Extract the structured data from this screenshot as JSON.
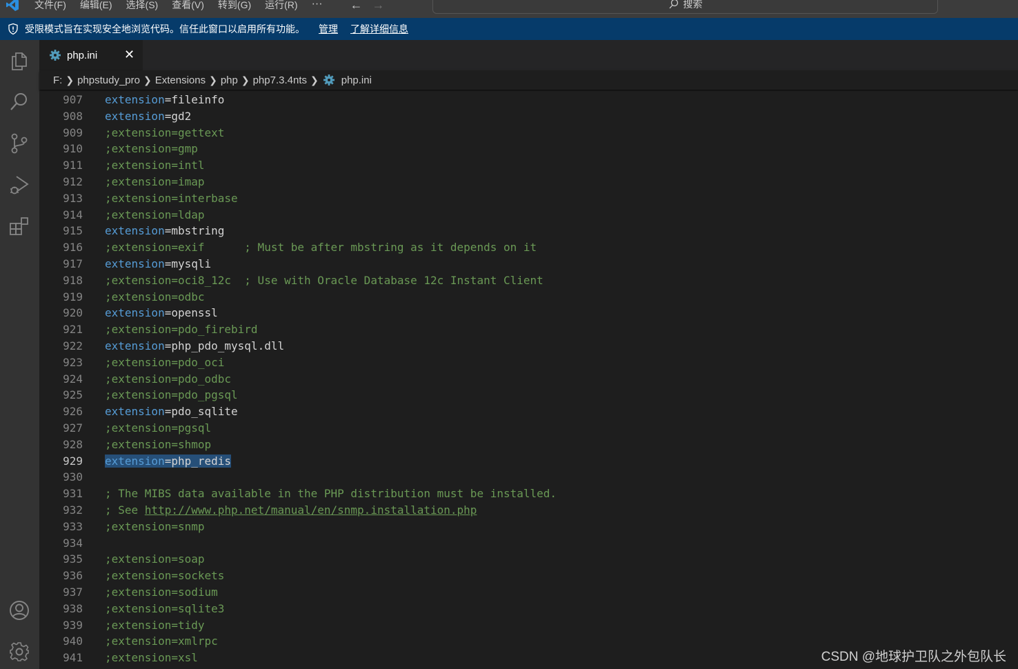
{
  "titlebar": {
    "menu": [
      "文件(F)",
      "编辑(E)",
      "选择(S)",
      "查看(V)",
      "转到(G)",
      "运行(R)"
    ],
    "more": "···",
    "back_icon": "←",
    "forward_icon": "→",
    "search_label": "搜索"
  },
  "banner": {
    "message": "受限模式旨在实现安全地浏览代码。信任此窗口以启用所有功能。",
    "manage": "管理",
    "learn_more": "了解详细信息"
  },
  "tab": {
    "label": "php.ini",
    "close": "✕"
  },
  "breadcrumb": [
    "F:",
    "phpstudy_pro",
    "Extensions",
    "php",
    "php7.3.4nts",
    "php.ini"
  ],
  "editor": {
    "active_line": "929",
    "lines": [
      {
        "n": "907",
        "kind": "ext",
        "kw": "extension",
        "val": "fileinfo"
      },
      {
        "n": "908",
        "kind": "ext",
        "kw": "extension",
        "val": "gd2"
      },
      {
        "n": "909",
        "kind": "comment",
        "text": ";extension=gettext"
      },
      {
        "n": "910",
        "kind": "comment",
        "text": ";extension=gmp"
      },
      {
        "n": "911",
        "kind": "comment",
        "text": ";extension=intl"
      },
      {
        "n": "912",
        "kind": "comment",
        "text": ";extension=imap"
      },
      {
        "n": "913",
        "kind": "comment",
        "text": ";extension=interbase"
      },
      {
        "n": "914",
        "kind": "comment",
        "text": ";extension=ldap"
      },
      {
        "n": "915",
        "kind": "ext",
        "kw": "extension",
        "val": "mbstring"
      },
      {
        "n": "916",
        "kind": "comment",
        "text": ";extension=exif      ; Must be after mbstring as it depends on it"
      },
      {
        "n": "917",
        "kind": "ext",
        "kw": "extension",
        "val": "mysqli"
      },
      {
        "n": "918",
        "kind": "comment",
        "text": ";extension=oci8_12c  ; Use with Oracle Database 12c Instant Client"
      },
      {
        "n": "919",
        "kind": "comment",
        "text": ";extension=odbc"
      },
      {
        "n": "920",
        "kind": "ext",
        "kw": "extension",
        "val": "openssl"
      },
      {
        "n": "921",
        "kind": "comment",
        "text": ";extension=pdo_firebird"
      },
      {
        "n": "922",
        "kind": "ext",
        "kw": "extension",
        "val": "php_pdo_mysql.dll"
      },
      {
        "n": "923",
        "kind": "comment",
        "text": ";extension=pdo_oci"
      },
      {
        "n": "924",
        "kind": "comment",
        "text": ";extension=pdo_odbc"
      },
      {
        "n": "925",
        "kind": "comment",
        "text": ";extension=pdo_pgsql"
      },
      {
        "n": "926",
        "kind": "ext",
        "kw": "extension",
        "val": "pdo_sqlite"
      },
      {
        "n": "927",
        "kind": "comment",
        "text": ";extension=pgsql"
      },
      {
        "n": "928",
        "kind": "comment",
        "text": ";extension=shmop"
      },
      {
        "n": "929",
        "kind": "ext",
        "kw": "extension",
        "val": "php_redis",
        "selected": true
      },
      {
        "n": "930",
        "kind": "empty",
        "text": ""
      },
      {
        "n": "931",
        "kind": "comment",
        "text": "; The MIBS data available in the PHP distribution must be installed."
      },
      {
        "n": "932",
        "kind": "see",
        "text": "; See ",
        "url": "http://www.php.net/manual/en/snmp.installation.php"
      },
      {
        "n": "933",
        "kind": "comment",
        "text": ";extension=snmp"
      },
      {
        "n": "934",
        "kind": "empty",
        "text": ""
      },
      {
        "n": "935",
        "kind": "comment",
        "text": ";extension=soap"
      },
      {
        "n": "936",
        "kind": "comment",
        "text": ";extension=sockets"
      },
      {
        "n": "937",
        "kind": "comment",
        "text": ";extension=sodium"
      },
      {
        "n": "938",
        "kind": "comment",
        "text": ";extension=sqlite3"
      },
      {
        "n": "939",
        "kind": "comment",
        "text": ";extension=tidy"
      },
      {
        "n": "940",
        "kind": "comment",
        "text": ";extension=xmlrpc"
      },
      {
        "n": "941",
        "kind": "comment",
        "text": ";extension=xsl"
      }
    ]
  },
  "watermark": "CSDN @地球护卫队之外包队长",
  "colors": {
    "titlebar": "#3c3c3c",
    "banner": "#063b6a",
    "activitybar": "#333333",
    "editor_bg": "#1e1e1e",
    "keyword": "#569cd6",
    "comment": "#6a9955",
    "selection": "#264f78"
  },
  "icons": {
    "activity": [
      "explorer-icon",
      "search-icon",
      "source-control-icon",
      "run-debug-icon",
      "extensions-icon",
      "account-icon",
      "settings-gear-icon"
    ]
  }
}
